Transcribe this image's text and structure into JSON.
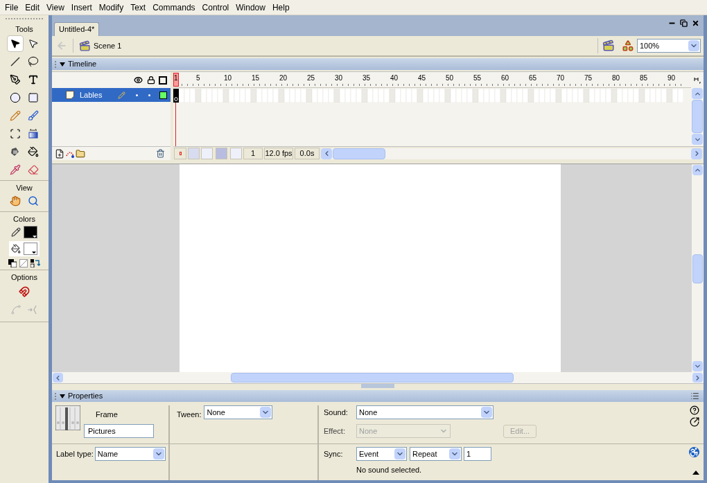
{
  "menu_bar": [
    "File",
    "Edit",
    "View",
    "Insert",
    "Modify",
    "Text",
    "Commands",
    "Control",
    "Window",
    "Help"
  ],
  "tools_panel": {
    "title": "Tools",
    "tools": [
      {
        "kind": "arrow",
        "selected": true
      },
      {
        "kind": "subselect",
        "selected": false
      },
      {
        "kind": "line",
        "selected": false
      },
      {
        "kind": "lasso",
        "selected": false
      },
      {
        "kind": "pen",
        "selected": false
      },
      {
        "kind": "text",
        "selected": false
      },
      {
        "kind": "oval",
        "selected": false
      },
      {
        "kind": "rectangle",
        "selected": false
      },
      {
        "kind": "pencil",
        "selected": false
      },
      {
        "kind": "brush",
        "selected": false
      },
      {
        "kind": "transform",
        "selected": false
      },
      {
        "kind": "gradient",
        "selected": false
      },
      {
        "kind": "inkbottle",
        "selected": false
      },
      {
        "kind": "bucket",
        "selected": false
      },
      {
        "kind": "eyedropper",
        "selected": false
      },
      {
        "kind": "eraser",
        "selected": false
      }
    ],
    "view_title": "View",
    "view_tools": [
      {
        "kind": "hand",
        "selected": false
      },
      {
        "kind": "zoom",
        "selected": false
      }
    ],
    "colors_title": "Colors",
    "options_title": "Options",
    "options": [
      {
        "kind": "magnet",
        "disabled": false
      },
      {
        "kind": "smooth",
        "disabled": true
      },
      {
        "kind": "straighten",
        "disabled": true
      }
    ]
  },
  "document": {
    "tab": "Untitled-4*",
    "scene": "Scene 1",
    "zoom": "100%"
  },
  "timeline": {
    "title": "Timeline",
    "ruler_labels": [
      "1",
      "5",
      "10",
      "15",
      "20",
      "25",
      "30",
      "35",
      "40",
      "45",
      "50",
      "55",
      "60",
      "65",
      "70",
      "75",
      "80",
      "85",
      "90"
    ],
    "layers": [
      {
        "name": "Lables",
        "selected": true,
        "color": "#66ff66"
      }
    ],
    "current_frame": "1",
    "frame_rate": "12.0 fps",
    "elapsed_time": "0.0s"
  },
  "properties": {
    "title": "Properties",
    "type": "Frame",
    "frame_label": "Pictures",
    "label_type_label": "Label type:",
    "label_type": "Name",
    "tween_label": "Tween:",
    "tween": "None",
    "sound_label": "Sound:",
    "sound": "None",
    "effect_label": "Effect:",
    "effect": "None",
    "effect_disabled": true,
    "edit_button": "Edit...",
    "edit_disabled": true,
    "sync_label": "Sync:",
    "sync": "Event",
    "repeat": "Repeat",
    "repeat_count": "1",
    "status": "No sound selected."
  }
}
